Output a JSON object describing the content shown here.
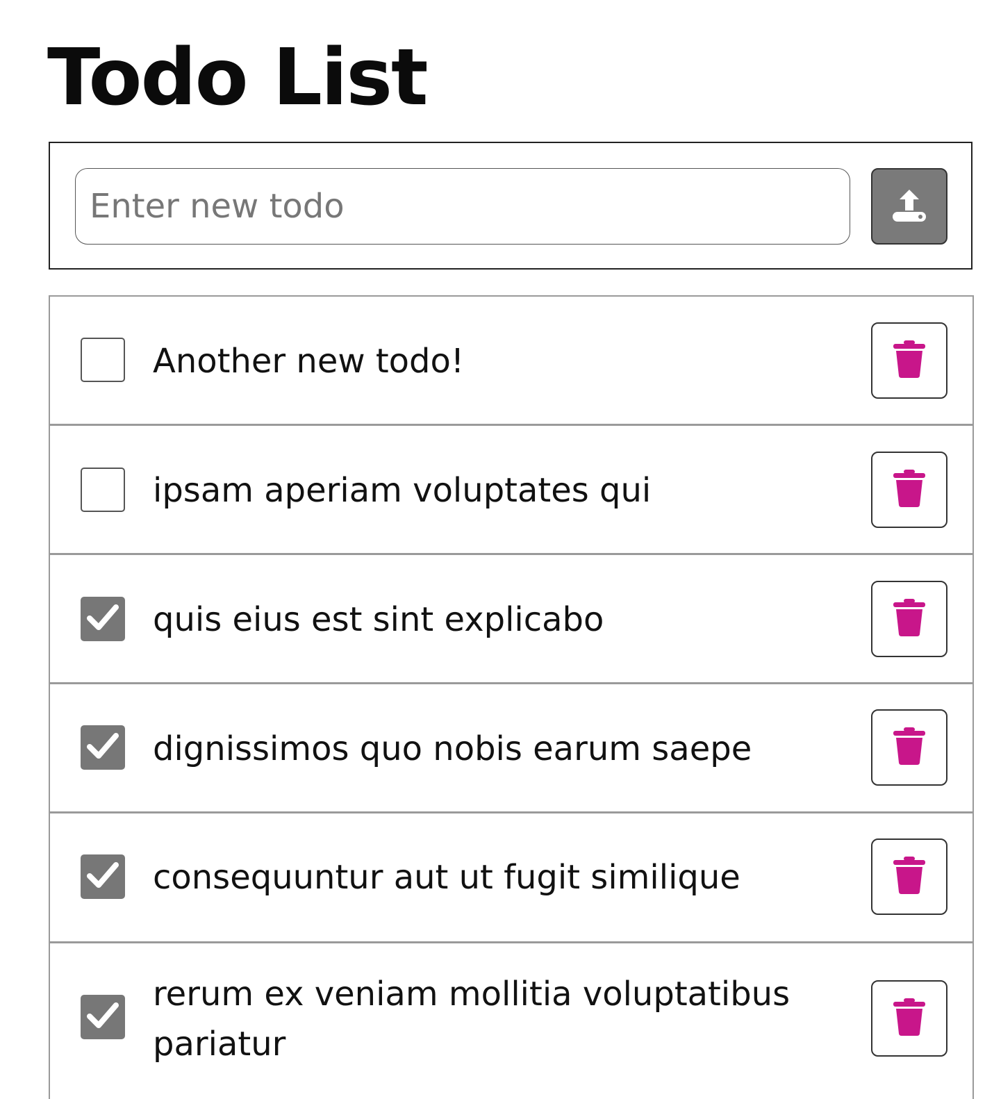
{
  "header": {
    "title": "Todo List"
  },
  "add_form": {
    "placeholder": "Enter new todo",
    "value": "",
    "button_icon": "upload-icon"
  },
  "colors": {
    "accent_delete": "#c8168a",
    "checked_box": "#777777",
    "add_button": "#7a7a7a"
  },
  "todos": [
    {
      "text": "Another new todo!",
      "completed": false
    },
    {
      "text": "ipsam aperiam voluptates qui",
      "completed": false
    },
    {
      "text": "quis eius est sint explicabo",
      "completed": true
    },
    {
      "text": "dignissimos quo nobis earum saepe",
      "completed": true
    },
    {
      "text": "consequuntur aut ut fugit similique",
      "completed": true
    },
    {
      "text": "rerum ex veniam mollitia voluptatibus pariatur",
      "completed": true
    }
  ]
}
